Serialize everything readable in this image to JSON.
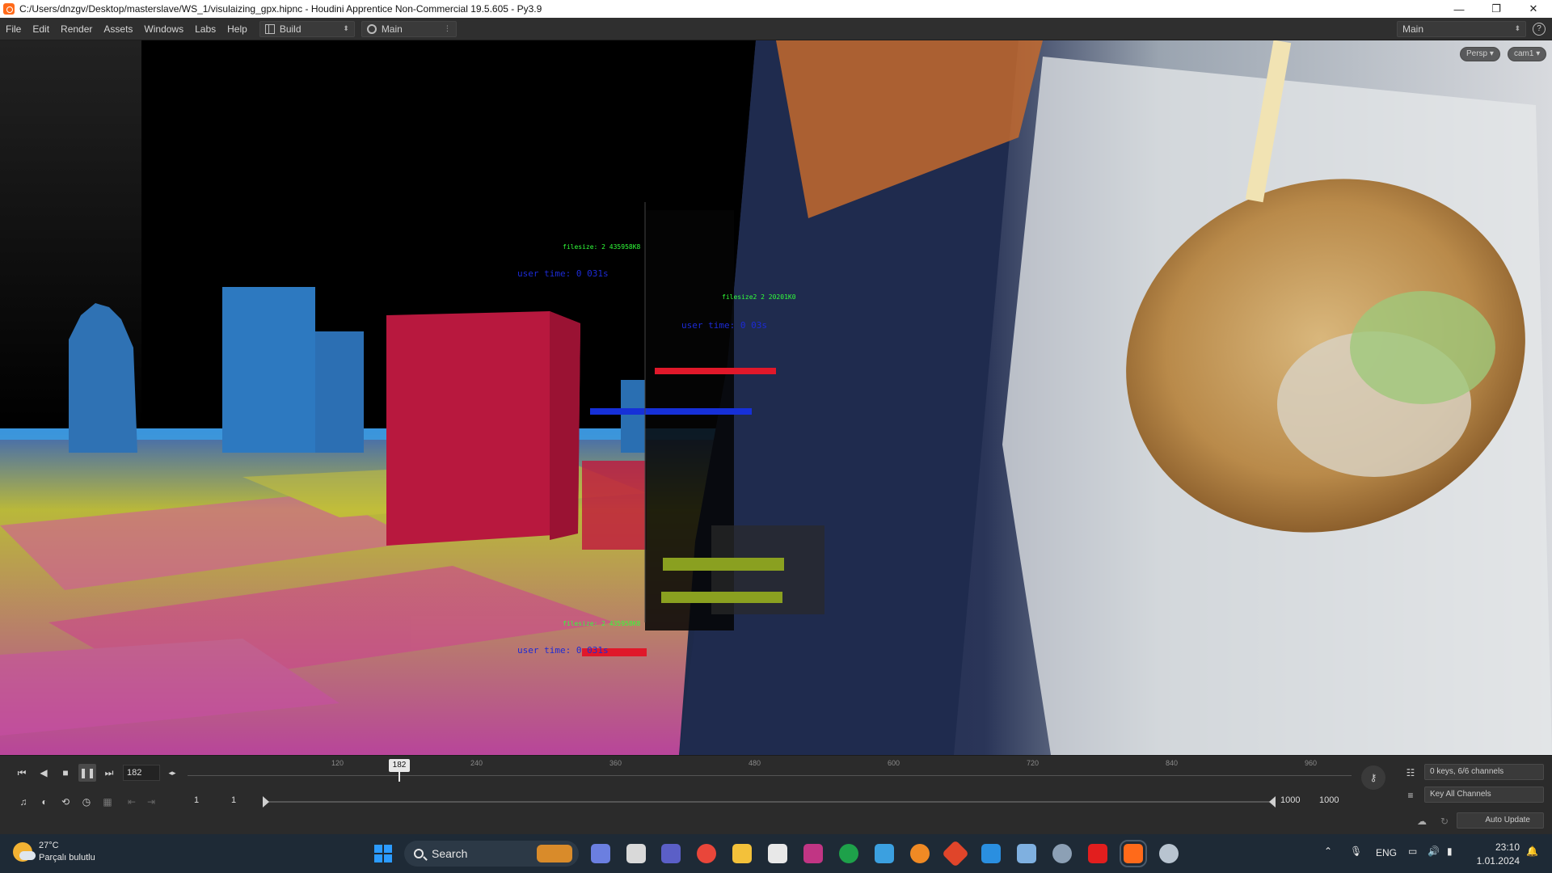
{
  "window": {
    "title": "C:/Users/dnzgv/Desktop/masterslave/WS_1/visulaizing_gpx.hipnc - Houdini Apprentice Non-Commercial 19.5.605 - Py3.9",
    "controls": {
      "minimize": "—",
      "maximize": "❐",
      "close": "✕"
    }
  },
  "menubar": {
    "items": [
      "File",
      "Edit",
      "Render",
      "Assets",
      "Windows",
      "Labs",
      "Help"
    ],
    "desktop_label": "Build",
    "network_label": "Main",
    "right_desk_label": "Main",
    "help_icon": "?"
  },
  "viewport": {
    "persp_label": "Persp ▾",
    "cam_label": "cam1 ▾",
    "overlays": [
      {
        "text": "filesize: 2 435958K8",
        "color": "#31ff3a"
      },
      {
        "text": "user time: 0 031s",
        "color": "#1c2bd6"
      },
      {
        "text": "filesize2 2 20201K0",
        "color": "#31ff3a"
      },
      {
        "text": "user time: 0 03s",
        "color": "#1c2bd6"
      },
      {
        "text": "filesize: 2 435958K8",
        "color": "#31ff3a"
      },
      {
        "text": "user time: 0 031s",
        "color": "#1c2bd6"
      }
    ]
  },
  "timeline": {
    "current_frame": "182",
    "frame_chip": "182",
    "ruler_ticks": [
      "120",
      "240",
      "360",
      "480",
      "600",
      "720",
      "840",
      "960"
    ],
    "start_frame": "1",
    "range_start": "1",
    "range_end": "1000",
    "end_frame": "1000",
    "keys_info": "0 keys, 6/6 channels",
    "key_all_label": "Key All Channels",
    "auto_update_label": "Auto Update"
  },
  "taskbar": {
    "weather_temp": "27°C",
    "weather_desc": "Parçalı bulutlu",
    "search_label": "Search",
    "language": "ENG",
    "time": "23:10",
    "date": "1.01.2024",
    "apps": [
      {
        "name": "start",
        "color": "#1a8cff"
      },
      {
        "name": "widgets",
        "color": "#f0a23a"
      },
      {
        "name": "copilot",
        "color": "#6b7fe0"
      },
      {
        "name": "file-explorer-mini",
        "color": "#d9d9d9"
      },
      {
        "name": "teams",
        "color": "#5b5fc7"
      },
      {
        "name": "chrome",
        "color": "#e9463a"
      },
      {
        "name": "file-explorer",
        "color": "#f3c13a"
      },
      {
        "name": "inkscape",
        "color": "#e8e8e8"
      },
      {
        "name": "instagram",
        "color": "#c13584"
      },
      {
        "name": "xbox",
        "color": "#1ea14a"
      },
      {
        "name": "notepad",
        "color": "#3ba0e0"
      },
      {
        "name": "blender",
        "color": "#f08a24"
      },
      {
        "name": "git",
        "color": "#e0452a"
      },
      {
        "name": "vscode",
        "color": "#2a8fe0"
      },
      {
        "name": "mail",
        "color": "#7fb0e0"
      },
      {
        "name": "settings",
        "color": "#8ca0b5"
      },
      {
        "name": "acrobat",
        "color": "#e21e1e"
      },
      {
        "name": "houdini",
        "color": "#ff6a1a"
      },
      {
        "name": "steam",
        "color": "#b8c4d0"
      }
    ]
  }
}
